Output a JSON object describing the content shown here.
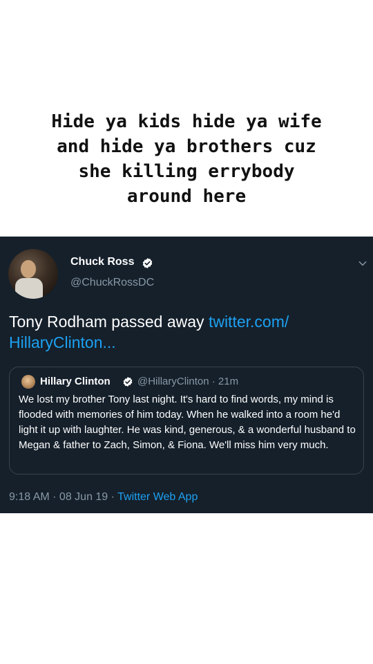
{
  "caption": {
    "lines": [
      "Hide ya kids hide ya wife",
      "and hide ya brothers cuz",
      "she killing errybody",
      "around here"
    ]
  },
  "tweet": {
    "display_name": "Chuck Ross",
    "handle": "@ChuckRossDC",
    "text": "Tony Rodham passed away ",
    "link_line1": "twitter.com/",
    "link_line2": "HillaryClinton...",
    "icons": {
      "avatar": "avatar-photo",
      "verified": "verified-badge-icon",
      "menu": "chevron-down-icon"
    },
    "quote": {
      "display_name": "Hillary Clinton",
      "handle_time": "@HillaryClinton · 21m",
      "text": "We lost my brother Tony last night. It's hard to find words, my mind is flooded with memories of him today. When he walked into a room he'd light it up with laughter. He was kind, generous, & a wonderful husband to Megan & father to Zach, Simon, & Fiona. We'll miss him very much."
    },
    "meta": {
      "time_date": "9:18 AM · 08 Jun 19 · ",
      "source": "Twitter Web App"
    }
  },
  "colors": {
    "card_bg": "#15202b",
    "link": "#1da1f2",
    "muted": "#8899a6",
    "border": "#38444d"
  }
}
